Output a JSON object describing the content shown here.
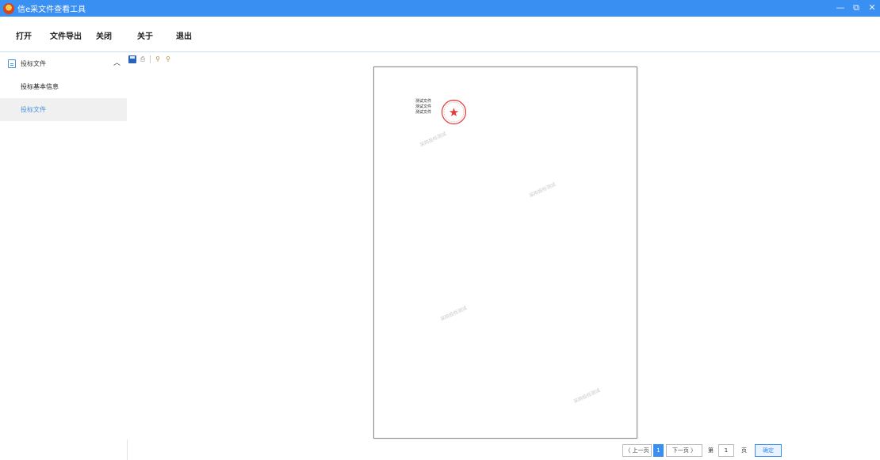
{
  "window": {
    "title": "信e采文件查看工具",
    "controls": {
      "minimize": "—",
      "restore": "⧉",
      "close": "✕"
    }
  },
  "menu": {
    "open": "打开",
    "export": "文件导出",
    "close": "关闭",
    "about": "关于",
    "exit": "退出"
  },
  "sidebar": {
    "header_label": "投标文件",
    "collapse_icon": "chevron-up-icon",
    "items": [
      {
        "label": "投标基本信息",
        "active": false
      },
      {
        "label": "投标文件",
        "active": true
      }
    ]
  },
  "toolbar": {
    "icons": [
      "save-icon",
      "print-icon",
      "zoom-in-icon",
      "zoom-out-icon"
    ]
  },
  "document": {
    "text_lines": [
      "测试文件",
      "测试文件",
      "测试文件"
    ],
    "seal_color": "#e23b3b",
    "watermark": "采购投标测试"
  },
  "pager": {
    "prev": "〈 上一页",
    "current_page": "1",
    "next": "下一页 〉",
    "goto_prefix": "第",
    "goto_value": "1",
    "goto_suffix": "页",
    "confirm": "确定"
  },
  "colors": {
    "accent": "#3a8ff2",
    "seal": "#e23b3b"
  }
}
